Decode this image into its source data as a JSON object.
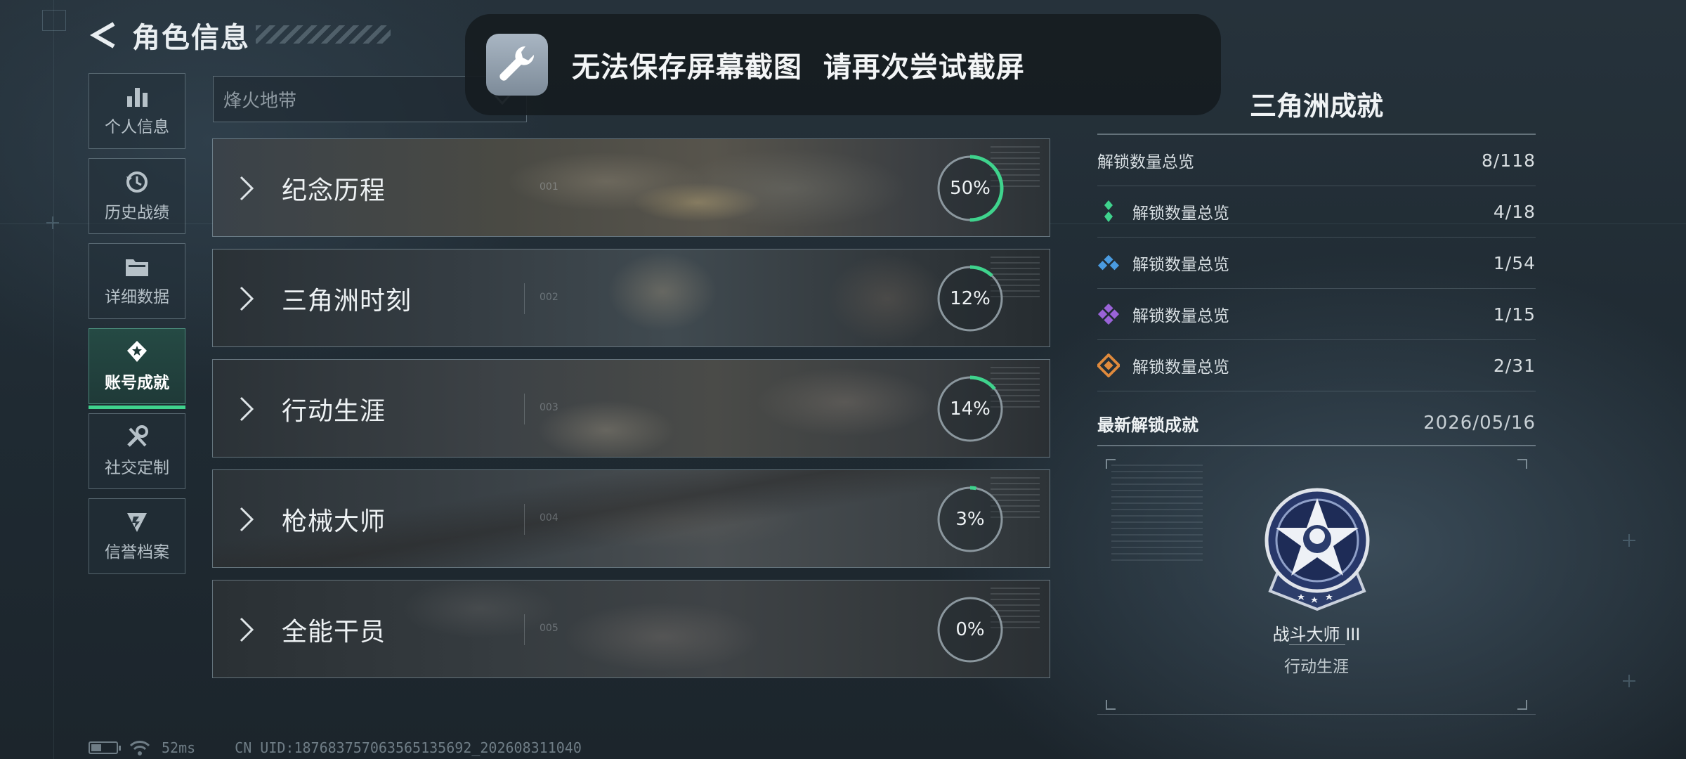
{
  "header": {
    "title": "角色信息"
  },
  "nav": {
    "items": [
      {
        "label": "个人信息",
        "icon": "bar-chart-icon",
        "active": false
      },
      {
        "label": "历史战绩",
        "icon": "history-clock-icon",
        "active": false
      },
      {
        "label": "详细数据",
        "icon": "folder-icon",
        "active": false
      },
      {
        "label": "账号成就",
        "icon": "achievement-star-icon",
        "active": true
      },
      {
        "label": "社交定制",
        "icon": "tools-icon",
        "active": false
      },
      {
        "label": "信誉档案",
        "icon": "credit-badge-icon",
        "active": false
      }
    ]
  },
  "mode_select": {
    "value": "烽火地带"
  },
  "toast": {
    "icon": "wrench-icon",
    "message": "无法保存屏幕截图  请再次尝试截屏"
  },
  "categories": [
    {
      "name": "纪念历程",
      "index": "001",
      "percent_label": "50%",
      "percent": 50
    },
    {
      "name": "三角洲时刻",
      "index": "002",
      "percent_label": "12%",
      "percent": 12
    },
    {
      "name": "行动生涯",
      "index": "003",
      "percent_label": "14%",
      "percent": 14
    },
    {
      "name": "枪械大师",
      "index": "004",
      "percent_label": "3%",
      "percent": 3
    },
    {
      "name": "全能干员",
      "index": "005",
      "percent_label": "0%",
      "percent": 0
    }
  ],
  "panel": {
    "title": "三角洲成就",
    "summary": {
      "label": "解锁数量总览",
      "count": "8/118"
    },
    "tiers": [
      {
        "label": "解锁数量总览",
        "count": "4/18",
        "color": "#3fd38d"
      },
      {
        "label": "解锁数量总览",
        "count": "1/54",
        "color": "#4a9be0"
      },
      {
        "label": "解锁数量总览",
        "count": "1/15",
        "color": "#9a63d8"
      },
      {
        "label": "解锁数量总览",
        "count": "2/31",
        "color": "#e08a3c"
      }
    ],
    "latest": {
      "label": "最新解锁成就",
      "date": "2026/05/16",
      "badge_name": "战斗大师 III",
      "badge_category": "行动生涯"
    }
  },
  "status": {
    "ping": "52ms",
    "uid": "CN UID:187683757063565135692_202608311040"
  },
  "colors": {
    "accent": "#3fd38d",
    "ring_track": "#8b979e"
  }
}
